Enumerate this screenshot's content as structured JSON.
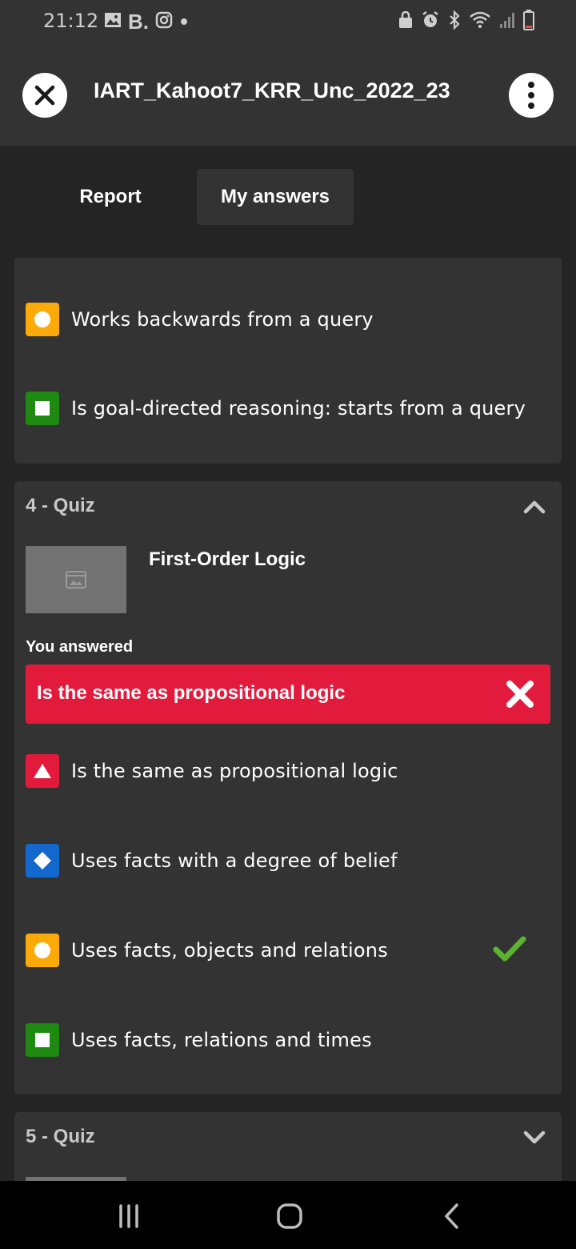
{
  "status_bar": {
    "time": "21:12",
    "left_icons": [
      "gallery-icon",
      "booking-icon",
      "instagram-icon",
      "dot-icon"
    ],
    "right_icons": [
      "lock-icon",
      "alarm-icon",
      "bluetooth-icon",
      "wifi-icon",
      "signal-icon",
      "battery-icon"
    ]
  },
  "header": {
    "title": "IART_Kahoot7_KRR_Unc_2022_23"
  },
  "tabs": [
    {
      "label": "Report",
      "active": false
    },
    {
      "label": "My answers",
      "active": true
    }
  ],
  "previous_question": {
    "options": [
      {
        "shape": "circle",
        "color": "#fbaa0a",
        "text": "Works backwards from a query"
      },
      {
        "shape": "square",
        "color": "#1f8a11",
        "text": "Is goal-directed reasoning: starts from a query"
      }
    ]
  },
  "question4": {
    "title": "4 - Quiz",
    "text": "First-Order Logic",
    "you_answered_label": "You answered",
    "answer": "Is the same as propositional logic",
    "answer_correct": false,
    "options": [
      {
        "shape": "triangle",
        "color": "#e21b3c",
        "text": "Is the same as propositional logic",
        "correct": false
      },
      {
        "shape": "diamond",
        "color": "#1368ce",
        "text": "Uses facts with a degree of belief",
        "correct": false
      },
      {
        "shape": "circle",
        "color": "#fbaa0a",
        "text": "Uses facts, objects and relations",
        "correct": true
      },
      {
        "shape": "square",
        "color": "#1f8a11",
        "text": "Uses facts, relations and times",
        "correct": false
      }
    ]
  },
  "question5": {
    "title": "5 - Quiz"
  },
  "colors": {
    "background": "#242424",
    "card": "#333333",
    "wrong_answer": "#e21b3c",
    "correct_check": "#5cb531"
  }
}
